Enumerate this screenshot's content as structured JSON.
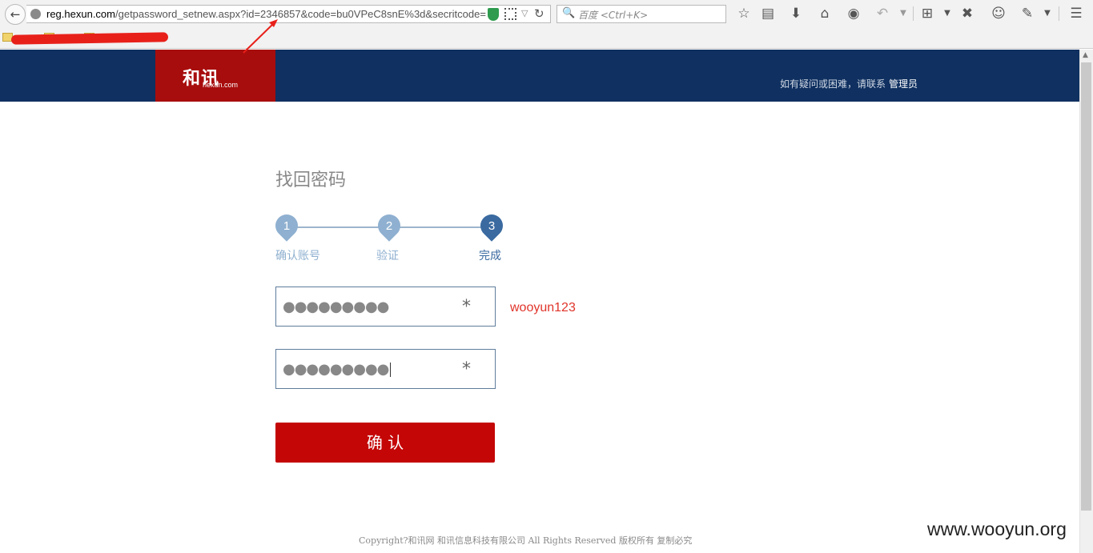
{
  "browser": {
    "url_host": "reg.hexun.com",
    "url_rest": "/getpassword_setnew.aspx?id=2346857&code=bu0VPeC8snE%3d&secritcode=",
    "search_placeholder": "百度 <Ctrl+K>"
  },
  "header": {
    "logo_text": "和讯",
    "logo_sub": "hexun.com",
    "contact_text": "如有疑问或困难，请联系",
    "contact_link": "管理员"
  },
  "main": {
    "title": "找回密码",
    "steps": [
      {
        "num": "1",
        "label": "确认账号",
        "active": false
      },
      {
        "num": "2",
        "label": "验证",
        "active": false
      },
      {
        "num": "3",
        "label": "完成",
        "active": true
      }
    ],
    "password_mask": "●●●●●●●●●",
    "confirm_mask": "●●●●●●●●●",
    "required_mark": "*",
    "password_note": "wooyun123",
    "submit_label": "确 认"
  },
  "footer": {
    "copyright": "Copyright?和讯网 和讯信息科技有限公司 All Rights Reserved 版权所有 复制必究"
  },
  "watermark": "www.wooyun.org",
  "colors": {
    "header_bg": "#0f3060",
    "logo_bg": "#a80d0d",
    "step_inactive": "#8fb0d0",
    "step_active": "#3a6aa0",
    "submit_bg": "#c40606",
    "note": "#e0342a"
  }
}
